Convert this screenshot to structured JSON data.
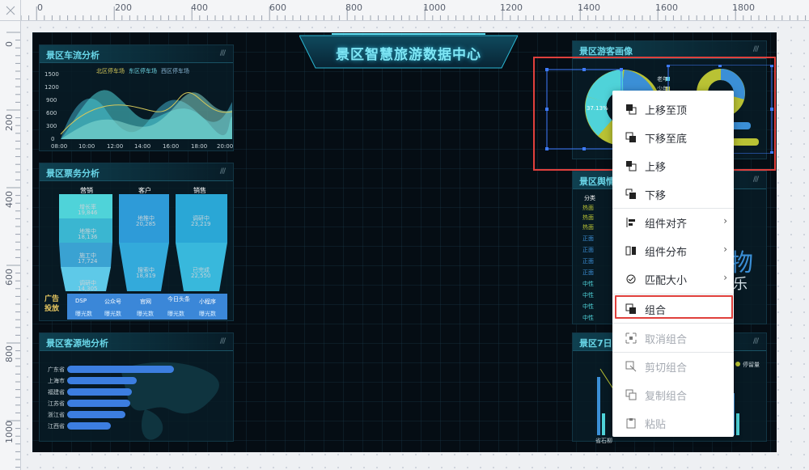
{
  "ruler": {
    "top_ticks": [
      "0",
      "200",
      "400",
      "600",
      "800",
      "1000",
      "1200",
      "1400",
      "1600",
      "1800"
    ],
    "left_ticks": [
      "0",
      "200",
      "400",
      "600",
      "800",
      "1000"
    ]
  },
  "dashboard": {
    "title": "景区智慧旅游数据中心",
    "panels": {
      "traffic": {
        "title": "景区车流分析",
        "legend": [
          "北区停车场",
          "东区停车场",
          "西区停车场"
        ],
        "y_ticks": [
          "1500",
          "1200",
          "900",
          "600",
          "300",
          "0"
        ],
        "x_ticks": [
          "08:00",
          "10:00",
          "12:00",
          "14:00",
          "16:00",
          "18:00",
          "20:00"
        ]
      },
      "tickets": {
        "title": "景区票务分析",
        "columns": [
          "营销",
          "客户",
          "销售"
        ],
        "col1": [
          {
            "name": "增长率",
            "value": "19,846"
          },
          {
            "name": "地推中",
            "value": "18,136"
          },
          {
            "name": "施工中",
            "value": "17,724"
          },
          {
            "name": "调研中",
            "value": "14,305"
          }
        ],
        "col2": [
          {
            "name": "地推中",
            "value": "20,285"
          },
          {
            "name": "搜索中",
            "value": "18,819"
          }
        ],
        "col3": [
          {
            "name": "调研中",
            "value": "23,219"
          },
          {
            "name": "已完成",
            "value": "22,550"
          }
        ],
        "ad_label": "广告投放",
        "ad_channels": [
          "DSP",
          "公众号",
          "官网",
          "今日头条",
          "小程序"
        ],
        "ad_metric": "曝光数"
      },
      "origin": {
        "title": "景区客源地分析",
        "regions": [
          "广东省",
          "上海市",
          "福建省",
          "江苏省",
          "浙江省",
          "江西省"
        ]
      },
      "visitors": {
        "title": "景区游客画像",
        "pie_label": "37.13%",
        "legend": [
          "老年",
          "少年"
        ]
      },
      "sentiment": {
        "title": "景区舆情",
        "header": "分类",
        "rows": [
          "热面",
          "热面",
          "热面",
          "正面",
          "正面",
          "正面",
          "正面",
          "中性",
          "中性",
          "中性",
          "中性"
        ]
      },
      "weekly": {
        "title": "景区7日",
        "x_label": "省石柳",
        "legend": "停留量"
      },
      "big_chars": [
        "物",
        "乐"
      ]
    }
  },
  "context_menu": {
    "items": [
      {
        "label": "上移至顶",
        "disabled": false,
        "submenu": false
      },
      {
        "label": "下移至底",
        "disabled": false,
        "submenu": false
      },
      {
        "label": "上移",
        "disabled": false,
        "submenu": false
      },
      {
        "label": "下移",
        "disabled": false,
        "submenu": false
      },
      {
        "label": "组件对齐",
        "disabled": false,
        "submenu": true
      },
      {
        "label": "组件分布",
        "disabled": false,
        "submenu": true
      },
      {
        "label": "匹配大小",
        "disabled": false,
        "submenu": true
      },
      {
        "label": "组合",
        "disabled": false,
        "submenu": false
      },
      {
        "label": "取消组合",
        "disabled": true,
        "submenu": false
      },
      {
        "label": "剪切组合",
        "disabled": true,
        "submenu": false
      },
      {
        "label": "复制组合",
        "disabled": true,
        "submenu": false
      },
      {
        "label": "粘贴",
        "disabled": true,
        "submenu": false
      }
    ],
    "submenu_arrow": "›"
  },
  "colors": {
    "accent": "#69d6e8",
    "highlight": "#e0403c",
    "selection": "#3e7bff",
    "chart_teal": "#4fd3d9",
    "chart_blue": "#3b8fd6",
    "chart_olive": "#b9c234"
  }
}
